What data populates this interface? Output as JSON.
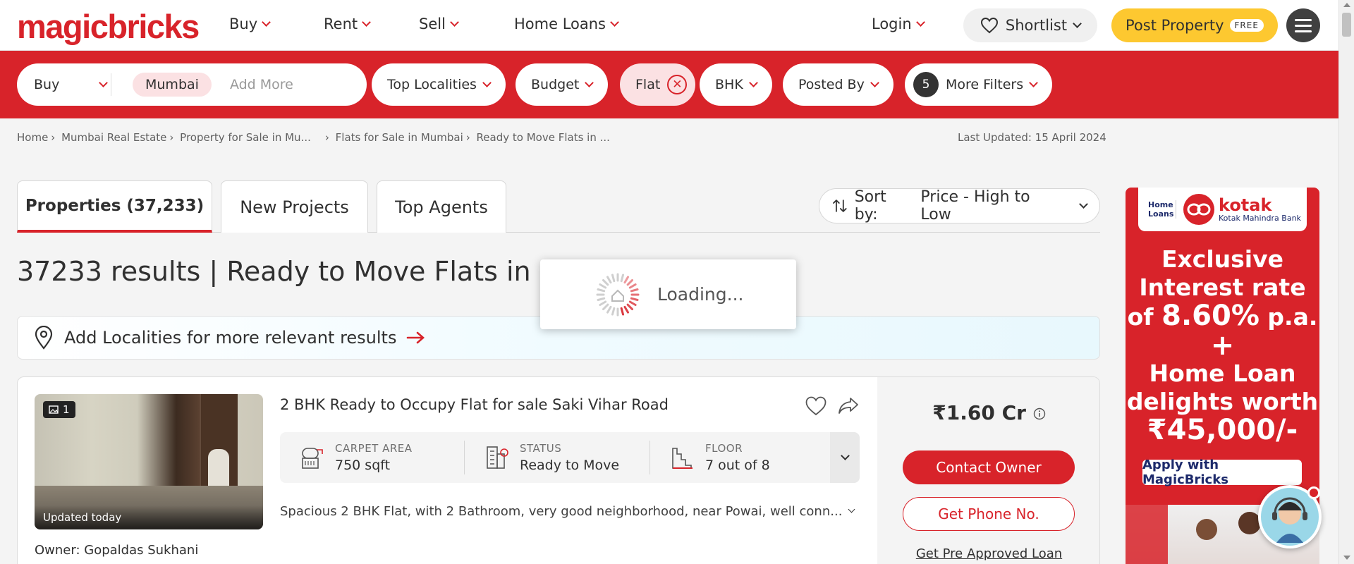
{
  "brand": {
    "logo": "magicbricks"
  },
  "nav": {
    "items": [
      {
        "label": "Buy"
      },
      {
        "label": "Rent"
      },
      {
        "label": "Sell"
      },
      {
        "label": "Home Loans"
      }
    ],
    "login": "Login",
    "shortlist": "Shortlist",
    "post_property": "Post Property",
    "free_badge": "FREE"
  },
  "filters": {
    "mode": "Buy",
    "city_chip": "Mumbai",
    "add_more_placeholder": "Add More",
    "top_localities": "Top Localities",
    "budget": "Budget",
    "flat": "Flat",
    "bhk": "BHK",
    "posted_by": "Posted By",
    "more_filters_count": "5",
    "more_filters": "More Filters"
  },
  "breadcrumb": [
    "Home",
    "Mumbai Real Estate",
    "Property for Sale in Mu...",
    "Flats for Sale in Mumbai",
    "Ready to Move Flats in ..."
  ],
  "last_updated": "Last Updated: 15 April 2024",
  "tabs": [
    {
      "label": "Properties (37,233)",
      "active": true
    },
    {
      "label": "New Projects"
    },
    {
      "label": "Top Agents"
    }
  ],
  "sort": {
    "prefix": "Sort by:",
    "value": "Price - High to Low"
  },
  "results_heading": "37233 results | Ready to Move Flats in Mumbai",
  "loader_text": "Loading...",
  "add_localities": "Add Localities for more relevant results",
  "listing": {
    "image_count": "1",
    "updated": "Updated today",
    "owner": "Owner: Gopaldas Sukhani",
    "title": "2 BHK Ready to Occupy Flat for sale Saki Vihar Road",
    "specs": [
      {
        "label": "CARPET AREA",
        "value": "750 sqft",
        "icon": "carpet-area-icon"
      },
      {
        "label": "STATUS",
        "value": "Ready to Move",
        "icon": "building-status-icon"
      },
      {
        "label": "FLOOR",
        "value": "7 out of 8",
        "icon": "floor-stairs-icon"
      }
    ],
    "description": "Spacious 2 BHK Flat, with 2 Bathroom, very good neighborhood, near Powai, well conn...",
    "price": "₹1.60 Cr",
    "contact_owner": "Contact Owner",
    "get_phone": "Get Phone No.",
    "pre_approved": "Get Pre Approved Loan"
  },
  "ad": {
    "home_loans": "Home Loans",
    "bank_name": "kotak",
    "bank_full": "Kotak Mahindra Bank",
    "line1": "Exclusive",
    "line2": "Interest rate",
    "line3_pre": "of ",
    "line3_rate": "8.60%",
    "line3_post": " p.a.",
    "plus": "+",
    "line4": "Home Loan",
    "line5": "delights worth",
    "line6": "₹45,000/-",
    "cta": "Apply with MagicBricks"
  },
  "colors": {
    "brand_red": "#d8232a",
    "accent_yellow": "#fdc830"
  }
}
